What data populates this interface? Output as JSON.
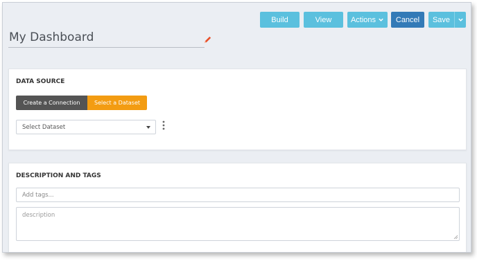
{
  "toolbar": {
    "build_label": "Build",
    "view_label": "View",
    "actions_label": "Actions",
    "cancel_label": "Cancel",
    "save_label": "Save"
  },
  "page": {
    "title": "My Dashboard",
    "edit_icon": "pencil-icon"
  },
  "data_source": {
    "heading": "DATA SOURCE",
    "tabs": [
      {
        "label": "Create a Connection",
        "active": false
      },
      {
        "label": "Select a Dataset",
        "active": true
      }
    ],
    "dataset_select": {
      "value": "Select Dataset"
    },
    "more_icon": "kebab-icon"
  },
  "description_tags": {
    "heading": "DESCRIPTION AND TAGS",
    "tags_placeholder": "Add tags...",
    "description_placeholder": "description"
  },
  "colors": {
    "primary_button": "#5bc0de",
    "cancel_button": "#337ab7",
    "active_tab": "#f39c12",
    "inactive_tab": "#545454",
    "edit_icon": "#e8502a",
    "background": "#ebeef3"
  }
}
